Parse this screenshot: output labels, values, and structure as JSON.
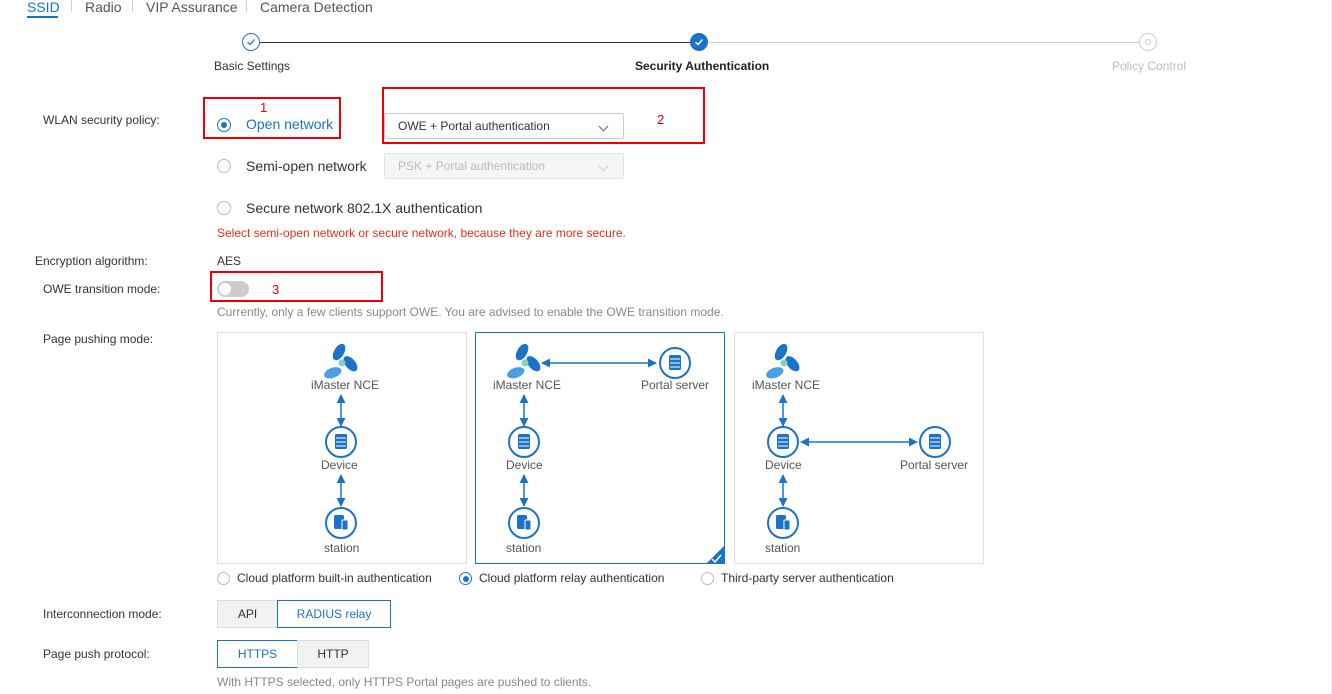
{
  "tabs": [
    "SSID",
    "Radio",
    "VIP Assurance",
    "Camera Detection"
  ],
  "steps": [
    "Basic Settings",
    "Security Authentication",
    "Policy Control"
  ],
  "security": {
    "label": "WLAN security policy:",
    "open": "Open network",
    "open_select": "OWE + Portal authentication",
    "semi": "Semi-open network",
    "semi_select": "PSK + Portal authentication",
    "secure": "Secure network",
    "secure_value": "802.1X authentication",
    "warning": "Select semi-open network or secure network, because they are more secure."
  },
  "annotations": [
    "1",
    "2",
    "3"
  ],
  "encryption": {
    "label": "Encryption algorithm:",
    "value": "AES"
  },
  "owe": {
    "label": "OWE transition mode:",
    "enabled": false,
    "hint": "Currently, only a few clients support OWE. You are advised to enable the OWE transition mode."
  },
  "push": {
    "label": "Page pushing mode:",
    "nodes": {
      "nce": "iMaster NCE",
      "device": "Device",
      "station": "station",
      "portal": "Portal server"
    },
    "options": [
      "Cloud platform built-in authentication",
      "Cloud platform relay authentication",
      "Third-party server authentication"
    ],
    "selected_index": 1
  },
  "interconnection": {
    "label": "Interconnection mode:",
    "options": [
      "API",
      "RADIUS relay"
    ],
    "selected": "RADIUS relay"
  },
  "protocol": {
    "label": "Page push protocol:",
    "options": [
      "HTTPS",
      "HTTP"
    ],
    "selected": "HTTPS",
    "hint": "With HTTPS selected, only HTTPS Portal pages are pushed to clients."
  },
  "colors": {
    "accent": "#1a73c9",
    "annotation": "#e00000",
    "warning": "#e0301e"
  }
}
